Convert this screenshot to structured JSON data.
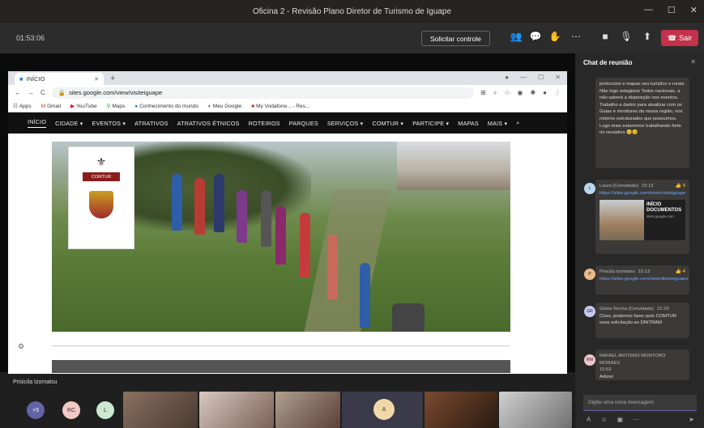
{
  "window": {
    "title": "Oficina 2 - Revisão Plano Diretor de Turismo de Iguape"
  },
  "meeting": {
    "timer": "01:53:06",
    "stop_control": "Solicitar controle",
    "leave": "Sair",
    "colors": {
      "leave": "#c4314b",
      "accent": "#6264a7"
    }
  },
  "browser": {
    "tab_title": "INÍCIO",
    "url": "sites.google.com/view/visiteiguape",
    "bookmarks": [
      "Apps",
      "Gmail",
      "YouTube",
      "Maps",
      "Conhecimento do mundo",
      "Meu Google",
      "My Vodafone... - Res..."
    ],
    "nav": [
      "INÍCIO",
      "CIDADE ▾",
      "EVENTOS ▾",
      "ATRATIVOS",
      "ATRATIVOS ÉTNICOS",
      "ROTEIROS",
      "PARQUES",
      "SERVIÇOS ▾",
      "COMTUR ▾",
      "PARTICIPE ▾",
      "MAPAS",
      "MAIS ▾"
    ],
    "logo_text": "COMTUR"
  },
  "speaker_label": "Prisicila Izomatsu",
  "participants": {
    "more": "+5",
    "initials": [
      "RC",
      "L",
      "A"
    ]
  },
  "chat": {
    "title": "Chat de reunião",
    "messages": [
      {
        "text": "protocolos e mapas seu turístico e rurais. Não logo estagiário Todos nacionais, a não saberá a disposição nos eventos. Trabalho a dados para atualizar com os Guias e monitores da nossa região, nos roteiros estruturados que possuímos. Logo mais estaremos trabalhando forte no receptivo 😊😊"
      },
      {
        "author": "Laura (Convidado)",
        "time": "15:13",
        "likes": "👍 4",
        "link": "https://sites.google.com/view/visiteiguape",
        "preview_title": "INÍCIO DOCUMENTOS",
        "preview_src": "sites.google.com",
        "initials": "L"
      },
      {
        "author": "Priscila Izomatsu",
        "time": "15:13",
        "likes": "👍 4",
        "link": "https://sites.google.com/view/diretoriguape",
        "initials": "P"
      },
      {
        "author": "Glória Rocha (Convidado)",
        "time": "15:29",
        "text": "Claro, podemos fazer pelo COMTUR essa solicitação ao DINTRAM",
        "initials": "GR"
      },
      {
        "author": "RAFAEL ANTONIO MONTORO MORAES",
        "time": "15:53",
        "text": "Adorei",
        "initials": "RM"
      }
    ],
    "compose_placeholder": "Digite uma nova mensagem"
  }
}
